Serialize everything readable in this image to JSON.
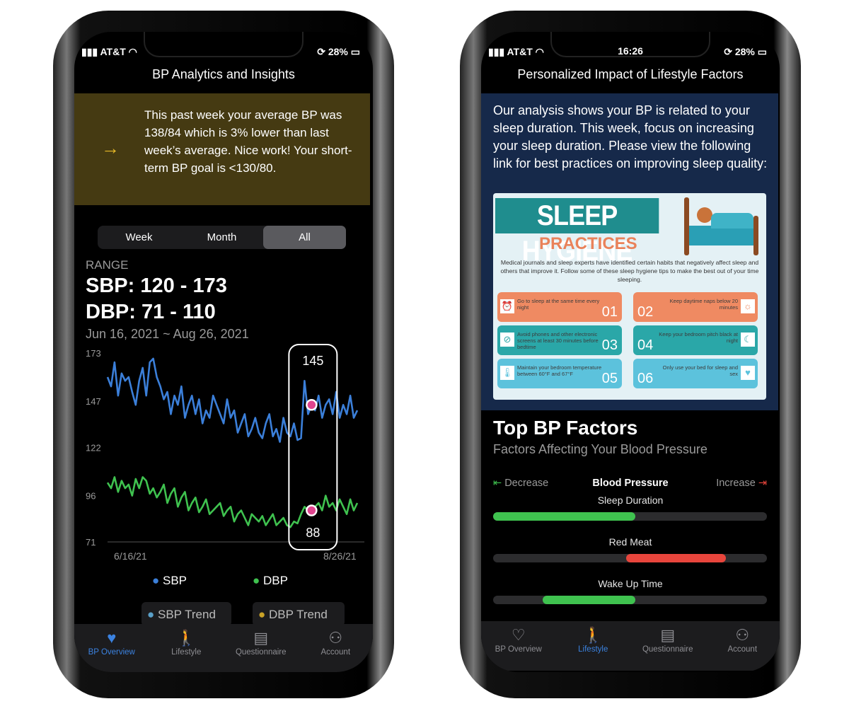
{
  "left": {
    "status": {
      "carrier": "AT&T",
      "battery": "28%"
    },
    "title": "BP Analytics and Insights",
    "insight": "This past week your average BP was 138/84 which is 3% lower than last week’s average. Nice work! Your short-term BP goal is <130/80.",
    "segments": [
      "Week",
      "Month",
      "All"
    ],
    "selected_segment": "All",
    "range_label": "RANGE",
    "sbp_range": "SBP: 120 - 173",
    "dbp_range": "DBP: 71 - 110",
    "date_range": "Jun 16, 2021 ~ Aug 26, 2021",
    "legend": [
      "SBP",
      "DBP"
    ],
    "trend_chips": [
      "SBP Trend",
      "DBP Trend"
    ],
    "tabs": [
      "BP Overview",
      "Lifestyle",
      "Questionnaire",
      "Account"
    ],
    "active_tab": "BP Overview"
  },
  "chart_data": {
    "type": "line",
    "ylim": [
      71,
      173
    ],
    "yticks": [
      "173",
      "147",
      "122",
      "96",
      "71"
    ],
    "xticks": [
      "6/16/21",
      "8/26/21"
    ],
    "series": [
      {
        "name": "SBP",
        "color": "#3b7fd9",
        "values": [
          160,
          155,
          168,
          150,
          162,
          158,
          160,
          152,
          145,
          158,
          165,
          150,
          168,
          170,
          160,
          155,
          148,
          152,
          140,
          150,
          145,
          155,
          138,
          145,
          150,
          140,
          148,
          135,
          142,
          138,
          150,
          145,
          140,
          135,
          148,
          138,
          142,
          130,
          135,
          140,
          128,
          132,
          138,
          130,
          127,
          135,
          140,
          128,
          132,
          125,
          138,
          130,
          128,
          135,
          126,
          127,
          158,
          140,
          145,
          142,
          150,
          138,
          145,
          148,
          140,
          152,
          138,
          145,
          140,
          150,
          138,
          142
        ]
      },
      {
        "name": "DBP",
        "color": "#3fc24f",
        "values": [
          103,
          100,
          106,
          98,
          104,
          100,
          102,
          96,
          105,
          100,
          106,
          104,
          97,
          100,
          95,
          98,
          102,
          92,
          97,
          100,
          90,
          95,
          98,
          88,
          92,
          95,
          87,
          90,
          94,
          86,
          88,
          90,
          92,
          85,
          88,
          90,
          82,
          86,
          88,
          84,
          80,
          86,
          84,
          82,
          85,
          80,
          83,
          86,
          80,
          82,
          84,
          80,
          79,
          82,
          81,
          86,
          90,
          88,
          88,
          90,
          92,
          88,
          96,
          90,
          92,
          88,
          94,
          90,
          86,
          94,
          88,
          92
        ]
      }
    ],
    "highlight": {
      "index": 58,
      "sbp": "145",
      "dbp": "88"
    },
    "trend_colors": {
      "SBP Trend": "#5aa0c8",
      "DBP Trend": "#c9a227"
    }
  },
  "right": {
    "status": {
      "carrier": "AT&T",
      "time": "16:26",
      "battery": "28%"
    },
    "title": "Personalized Impact of Lifestyle Factors",
    "analysis": "Our analysis shows your BP is related to your sleep duration. This week, focus on increasing your sleep duration. Please view the following link for best practices on improving sleep quality:",
    "infographic": {
      "title": "SLEEP HYGIENE",
      "subtitle": "PRACTICES",
      "intro": "Medical journals and sleep experts have identified certain habits that negatively affect sleep and others that improve it. Follow some of these sleep hygiene tips to make the best out of your time sleeping.",
      "tips": [
        {
          "num": "01",
          "text": "Go to sleep at the same time every night"
        },
        {
          "num": "02",
          "text": "Keep daytime naps below 20 minutes"
        },
        {
          "num": "03",
          "text": "Avoid phones and other electronic screens at least 30 minutes before bedtime"
        },
        {
          "num": "04",
          "text": "Keep your bedroom pitch black at night"
        },
        {
          "num": "05",
          "text": "Maintain your bedroom temperature between 60°F and 67°F"
        },
        {
          "num": "06",
          "text": "Only use your bed for sleep and sex"
        }
      ]
    },
    "factors_title": "Top BP Factors",
    "factors_subtitle": "Factors Affecting Your Blood Pressure",
    "axis": {
      "decrease": "Decrease",
      "center": "Blood Pressure",
      "increase": "Increase"
    },
    "factors": [
      {
        "name": "Sleep Duration",
        "effect": "decrease",
        "start": 0.0,
        "end": 0.52,
        "color": "#3fc24f"
      },
      {
        "name": "Red Meat",
        "effect": "increase",
        "start": 0.485,
        "end": 0.85,
        "color": "#e8453c"
      },
      {
        "name": "Wake Up Time",
        "effect": "decrease",
        "start": 0.18,
        "end": 0.52,
        "color": "#3fc24f"
      }
    ],
    "tabs": [
      "BP Overview",
      "Lifestyle",
      "Questionnaire",
      "Account"
    ],
    "active_tab": "Lifestyle"
  }
}
